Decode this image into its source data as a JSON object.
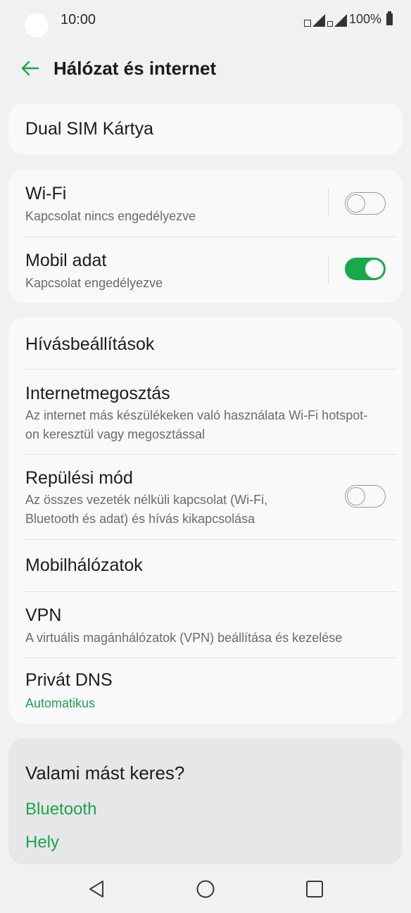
{
  "status_bar": {
    "time": "10:00",
    "battery": "100%"
  },
  "app_bar": {
    "title": "Hálózat és internet"
  },
  "dual_sim": {
    "label": "Dual SIM Kártya"
  },
  "wifi": {
    "label": "Wi-Fi",
    "subtitle": "Kapcsolat nincs engedélyezve",
    "enabled": false
  },
  "mobile_data": {
    "label": "Mobil adat",
    "subtitle": "Kapcsolat engedélyezve",
    "enabled": true
  },
  "settings": {
    "call_settings": {
      "label": "Hívásbeállítások"
    },
    "tethering": {
      "label": "Internetmegosztás",
      "subtitle": "Az internet más készülékeken való használata Wi-Fi hotspot-on keresztül vagy megosztással"
    },
    "airplane": {
      "label": "Repülési mód",
      "subtitle": "Az összes vezeték nélküli kapcsolat (Wi-Fi, Bluetooth és adat) és hívás kikapcsolása",
      "enabled": false
    },
    "mobile_networks": {
      "label": "Mobilhálózatok"
    },
    "vpn": {
      "label": "VPN",
      "subtitle": "A virtuális magánhálózatok (VPN) beállítása és kezelése"
    },
    "private_dns": {
      "label": "Privát DNS",
      "subtitle": "Automatikus"
    }
  },
  "search_suggestions": {
    "question": "Valami mást keres?",
    "links": [
      "Bluetooth",
      "Hely"
    ]
  },
  "colors": {
    "accent": "#1aa351",
    "toggle_on": "#17a94c"
  },
  "icons": {
    "back": "back-arrow-icon",
    "nav_back": "nav-back-icon",
    "nav_home": "nav-home-icon",
    "nav_recents": "nav-recents-icon"
  }
}
